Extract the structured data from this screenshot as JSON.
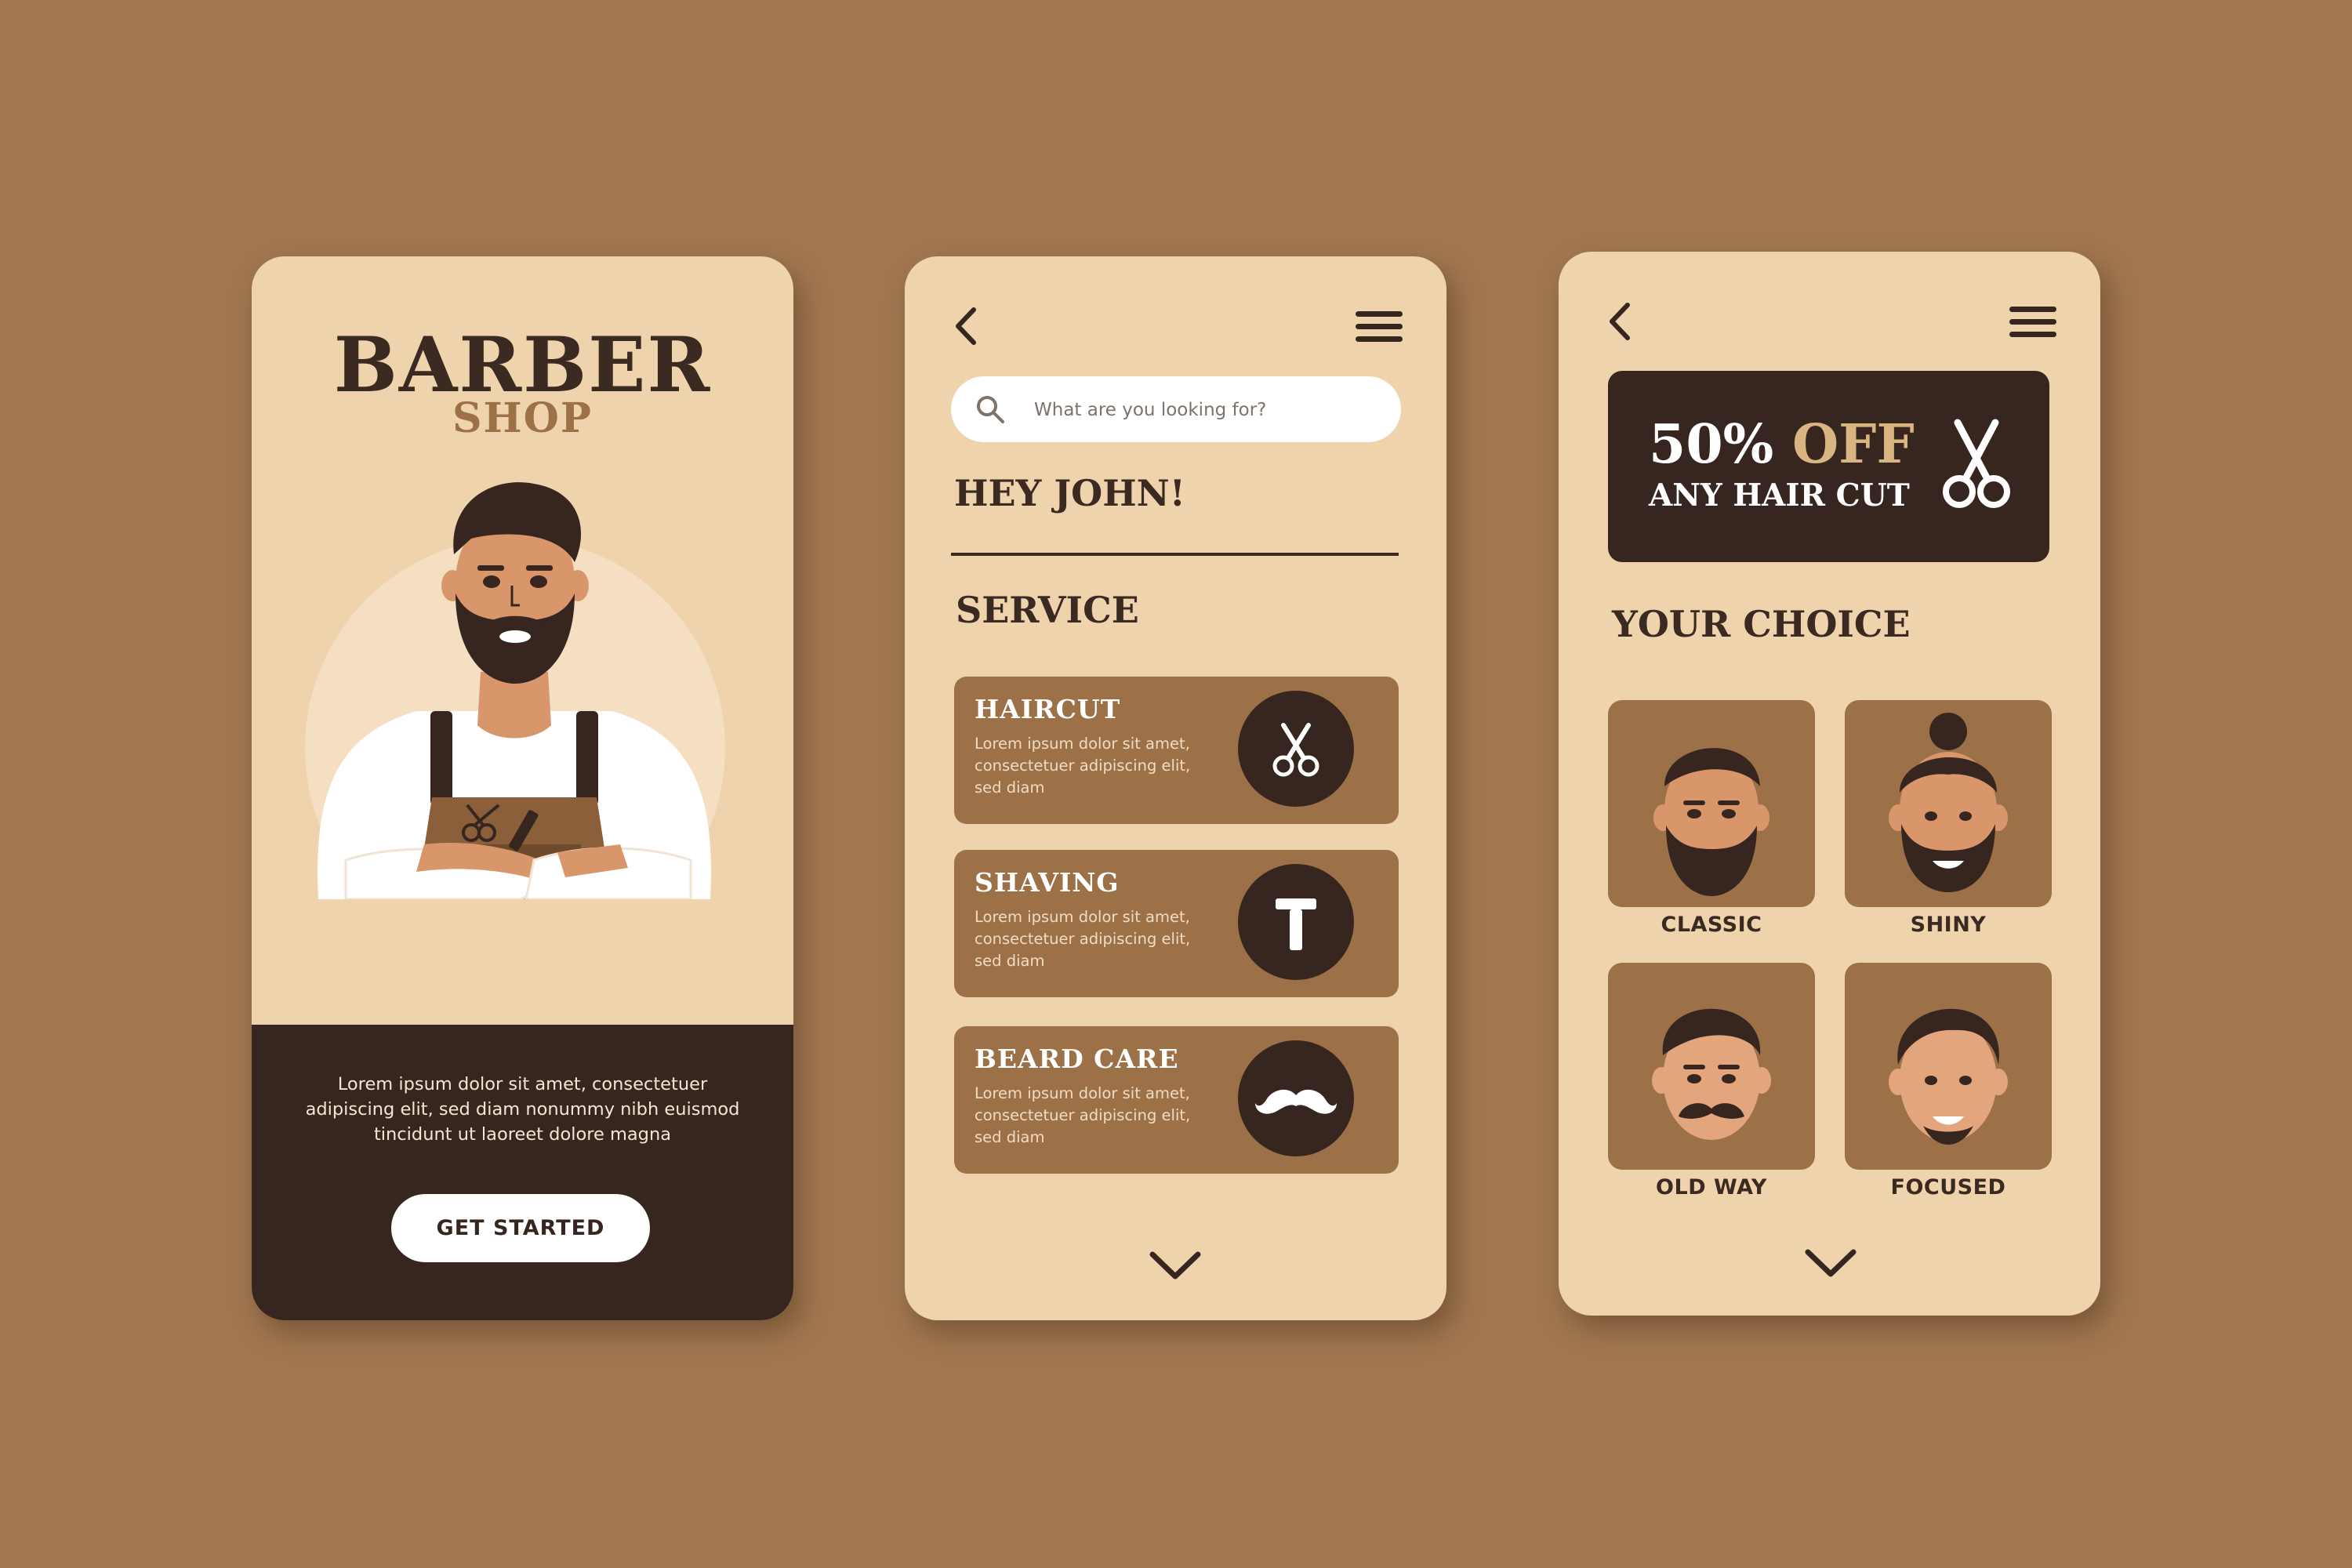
{
  "welcome_screen": {
    "title": "BARBER",
    "subtitle": "SHOP",
    "description": "Lorem ipsum dolor sit amet, consectetuer adipiscing elit, sed diam nonummy nibh euismod tincidunt ut laoreet dolore magna",
    "cta_label": "GET STARTED"
  },
  "services_screen": {
    "search_placeholder": "What are you looking for?",
    "greeting": "HEY JOHN!",
    "section_title": "SERVICE",
    "services": [
      {
        "name": "HAIRCUT",
        "description": "Lorem ipsum dolor sit amet, consectetuer adipiscing elit, sed diam",
        "icon": "scissors-icon"
      },
      {
        "name": "SHAVING",
        "description": "Lorem ipsum dolor sit amet, consectetuer adipiscing elit, sed diam",
        "icon": "razor-icon"
      },
      {
        "name": "BEARD CARE",
        "description": "Lorem ipsum dolor sit amet, consectetuer adipiscing elit, sed diam",
        "icon": "mustache-icon"
      }
    ]
  },
  "choice_screen": {
    "promo_percent": "50%",
    "promo_off": "OFF",
    "promo_subtitle": "ANY HAIR CUT",
    "section_title": "YOUR CHOICE",
    "choices": [
      {
        "label": "CLASSIC"
      },
      {
        "label": "SHINY"
      },
      {
        "label": "OLD WAY"
      },
      {
        "label": "FOCUSED"
      }
    ]
  },
  "colors": {
    "background": "#a07750",
    "screen": "#efd3ac",
    "dark": "#36261f",
    "card": "#9c7148",
    "accent": "#d9b581"
  }
}
